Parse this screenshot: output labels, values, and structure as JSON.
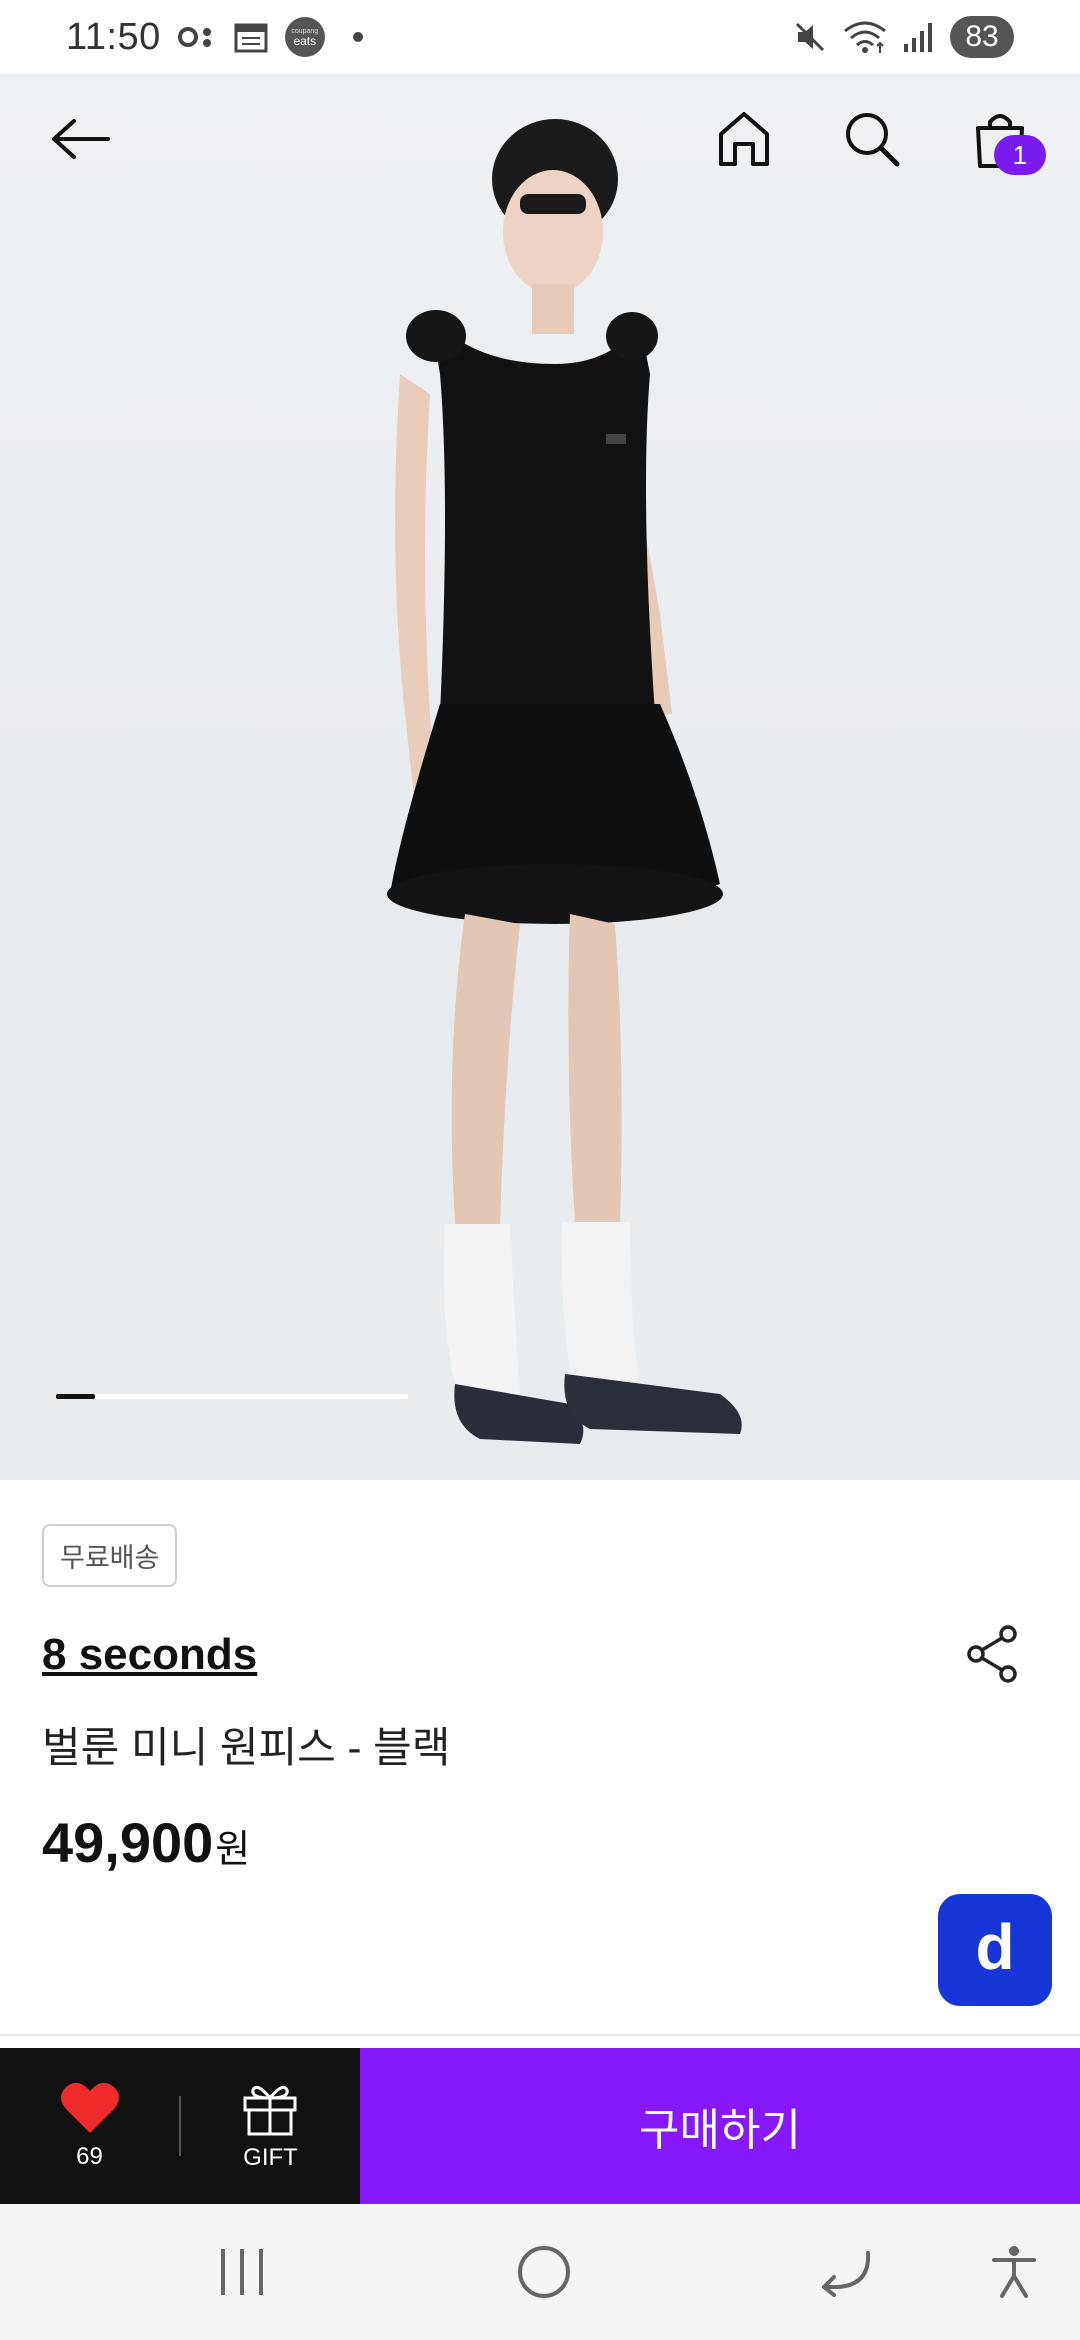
{
  "status_bar": {
    "time": "11:50",
    "eats_badge_small": "coupang",
    "eats_badge_text": "eats",
    "battery": "83"
  },
  "hero": {
    "carousel_progress": 0.11
  },
  "header": {
    "cart_count": "1"
  },
  "product": {
    "tag": "무료배송",
    "brand": "8 seconds",
    "name": "벌룬 미니 원피스 - 블랙",
    "price": "49,900",
    "price_unit": "원"
  },
  "fab": {
    "letter": "d"
  },
  "actions": {
    "like_count": "69",
    "gift_label": "GIFT",
    "buy_label": "구매하기"
  },
  "colors": {
    "accent": "#8718fb",
    "fab": "#1836d8",
    "heart": "#ef2b2b",
    "dark_bar": "#111111"
  },
  "icons": [
    "back-arrow-icon",
    "home-icon",
    "search-icon",
    "bag-icon",
    "share-icon",
    "heart-icon",
    "gift-icon",
    "recents-icon",
    "home-circle-icon",
    "back-nav-icon",
    "accessibility-icon"
  ]
}
